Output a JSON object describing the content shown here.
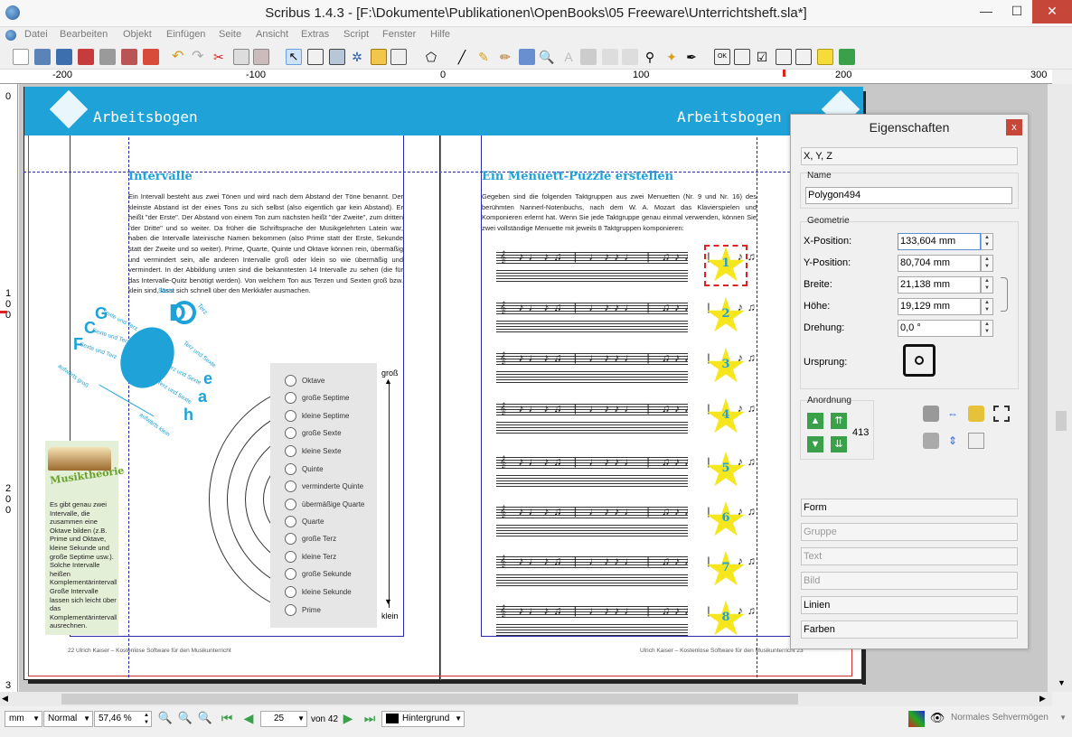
{
  "window": {
    "title": "Scribus 1.4.3 - [F:\\Dokumente\\Publikationen\\OpenBooks\\05 Freeware\\Unterrichtsheft.sla*]",
    "minimize": "—",
    "maximize": "☐",
    "close": "✕"
  },
  "menu": [
    "Datei",
    "Bearbeiten",
    "Objekt",
    "Einfügen",
    "Seite",
    "Ansicht",
    "Extras",
    "Script",
    "Fenster",
    "Hilfe"
  ],
  "ruler": {
    "h_labels": [
      "-200",
      "-100",
      "0",
      "100",
      "200",
      "300"
    ],
    "v_labels": [
      "0",
      "1",
      "0",
      "0",
      "2",
      "0",
      "0",
      "3"
    ]
  },
  "left_page": {
    "band_title": "Arbeitsbogen",
    "heading": "Intervalle",
    "body": "Ein Intervall besteht aus zwei Tönen und wird nach dem Abstand der Töne benannt. Der kleinste Abstand ist der eines Tons zu sich selbst (also eigentlich gar kein Abstand). Er heißt \"der Erste\". Der Abstand von einem Ton zum nächsten heißt \"der Zweite\", zum dritten \"der Dritte\" und so weiter. Da früher die Schriftsprache der Musikgelehrten Latein war, haben die Intervalle lateinische Namen bekommen (also Prime statt der Erste, Sekunde statt der Zweite und so weiter). Prime, Quarte, Quinte und Oktave können rein, übermäßig und vermindert sein, alle anderen Intervalle groß oder klein so wie übermäßig und vermindert. In der Abbildung unten sind die bekanntesten 14 Intervalle zu sehen (die für das Intervalle-Quitz benötigt werden). Von welchem Ton aus Terzen und Sexten groß bzw. klein sind, lässt sich schnell über den Merkkäfer ausmachen.",
    "beetle_letters": [
      "D",
      "G",
      "C",
      "F",
      "e",
      "a",
      "h"
    ],
    "beetle_labels": [
      "Sexte",
      "Terz",
      "Sexte und Terz",
      "Sexte und Terz",
      "Sexte und Terz",
      "Terz und Sexte",
      "Terz und Sexte",
      "Terz und Sexte",
      "aufwärts groß",
      "aufwärts klein"
    ],
    "sidebar_title": "Musiktheorie",
    "sidebar_text": "Es gibt genau zwei Intervalle, die zusammen eine Oktave bilden (z.B. Prime und Oktave, kleine Sekunde und große Septime usw.). Solche Intervalle heißen Komplementärintervalle. Große Intervalle lassen sich leicht über das Komplementärintervall ausrechnen.",
    "intervals": [
      "Oktave",
      "große Septime",
      "kleine Septime",
      "große Sexte",
      "kleine Sexte",
      "Quinte",
      "verminderte Quinte",
      "übermäßige Quarte",
      "Quarte",
      "große Terz",
      "kleine Terz",
      "große Sekunde",
      "kleine Sekunde",
      "Prime"
    ],
    "arrow_top": "groß",
    "arrow_bottom": "klein",
    "footer": "22   Ulrich Kaiser – Kostenlose Software für den Musikunterricht"
  },
  "right_page": {
    "band_title": "Arbeitsbogen",
    "heading": "Ein Menuett-Puzzle erstellen",
    "body": "Gegeben sind die folgenden Taktgruppen aus zwei Menuetten (Nr. 9 und Nr. 16) des berühmten Nannerl-Notenbuchs, nach dem W. A. Mozart das Klavierspielen und Komponieren erlernt hat. Wenn Sie jede Taktgruppe genau einmal verwenden, können Sie zwei vollständige Menuette mit jeweils 8 Taktgruppen komponieren:",
    "stars": [
      "1",
      "2",
      "3",
      "4",
      "5",
      "6",
      "7",
      "8"
    ],
    "footer": "Ulrich Kaiser – Kostenlose Software für den Musikunterricht   23"
  },
  "properties": {
    "title": "Eigenschaften",
    "close": "x",
    "section_xyz": "X, Y, Z",
    "name_label": "Name",
    "name_value": "Polygon494",
    "geometry_label": "Geometrie",
    "x_label": "X-Position:",
    "x_value": "133,604 mm",
    "y_label": "Y-Position:",
    "y_value": "80,704 mm",
    "w_label": "Breite:",
    "w_value": "21,138 mm",
    "h_label": "Höhe:",
    "h_value": "19,129 mm",
    "rot_label": "Drehung:",
    "rot_value": "0,0 °",
    "origin_label": "Ursprung:",
    "order_label": "Anordnung",
    "order_value": "413",
    "sections": [
      "Form",
      "Gruppe",
      "Text",
      "Bild",
      "Linien",
      "Farben"
    ]
  },
  "status": {
    "unit": "mm",
    "mode": "Normal",
    "zoom": "57,46 %",
    "page": "25",
    "of_pages": "von 42",
    "layer": "Hintergrund",
    "vision": "Normales Sehvermögen"
  },
  "colors": {
    "accent": "#1ea2d8",
    "panel_close": "#c7463a",
    "star": "#f5e61e",
    "sidebar_box": "#e3efd6"
  }
}
